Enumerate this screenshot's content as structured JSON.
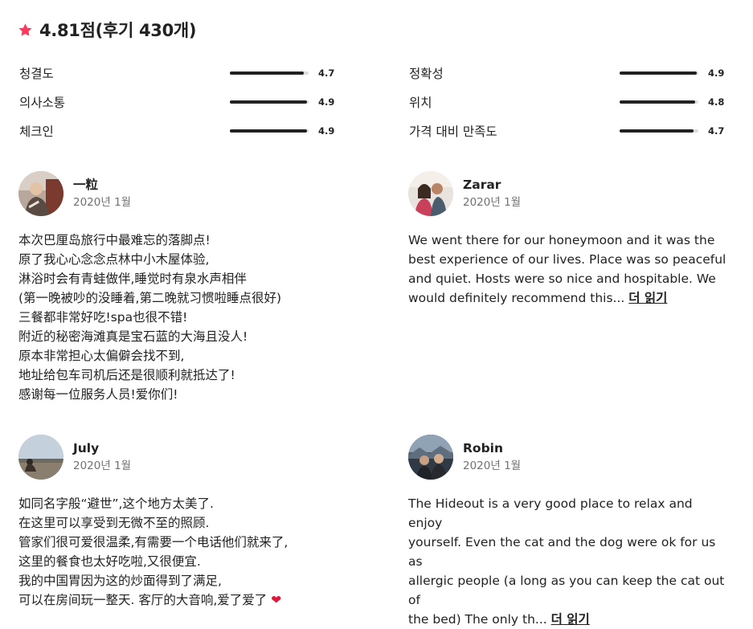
{
  "header": {
    "title": "4.81점(후기 430개)",
    "star_color": "#ff385c",
    "star_icon": "star-icon"
  },
  "ratings": [
    {
      "label": "청결도",
      "value": "4.7",
      "score": 4.7
    },
    {
      "label": "의사소통",
      "value": "4.9",
      "score": 4.9
    },
    {
      "label": "체크인",
      "value": "4.9",
      "score": 4.9
    },
    {
      "label": "정확성",
      "value": "4.9",
      "score": 4.9
    },
    {
      "label": "위치",
      "value": "4.8",
      "score": 4.8
    },
    {
      "label": "가격 대비 만족도",
      "value": "4.7",
      "score": 4.7
    }
  ],
  "reviews": [
    {
      "name": "一粒",
      "date": "2020년 1월",
      "text": "本次巴厘岛旅行中最难忘的落脚点!\n原了我心心念念点林中小木屋体验,\n淋浴时会有青蛙做伴,睡觉时有泉水声相伴\n(第一晚被吵的没睡着,第二晚就习惯啦睡点很好)\n三餐都非常好吃!spa也很不错!\n附近的秘密海滩真是宝石蓝的大海且没人!\n原本非常担心太偏僻会找不到,\n地址给包车司机后还是很顺利就抵达了!\n感谢每一位服务人员!爱你们!"
    },
    {
      "name": "Zarar",
      "date": "2020년 1월",
      "text": "We went there for our honeymoon and it was the\nbest experience of our lives. Place was so peaceful\nand quiet. Hosts were so nice and hospitable. We\nwould definitely recommend this... ",
      "read_more": "더 읽기"
    },
    {
      "name": "July",
      "date": "2020년 1월",
      "text": "如同名字般“避世”,这个地方太美了.\n在这里可以享受到无微不至的照顾.\n管家们很可爱很温柔,有需要一个电话他们就来了,\n这里的餐食也太好吃啦,又很便宜.\n我的中国胃因为这的炒面得到了满足,\n可以在房间玩一整天. 客厅的大音响,爱了爱了",
      "heart": "❤"
    },
    {
      "name": "Robin",
      "date": "2020년 1월",
      "text": "The Hideout is a very good place to relax and enjoy\nyourself. Even the cat and the dog were ok for us as\nallergic people (a long as you can keep the cat out of\nthe bed) The only th... ",
      "read_more": "더 읽기"
    }
  ]
}
